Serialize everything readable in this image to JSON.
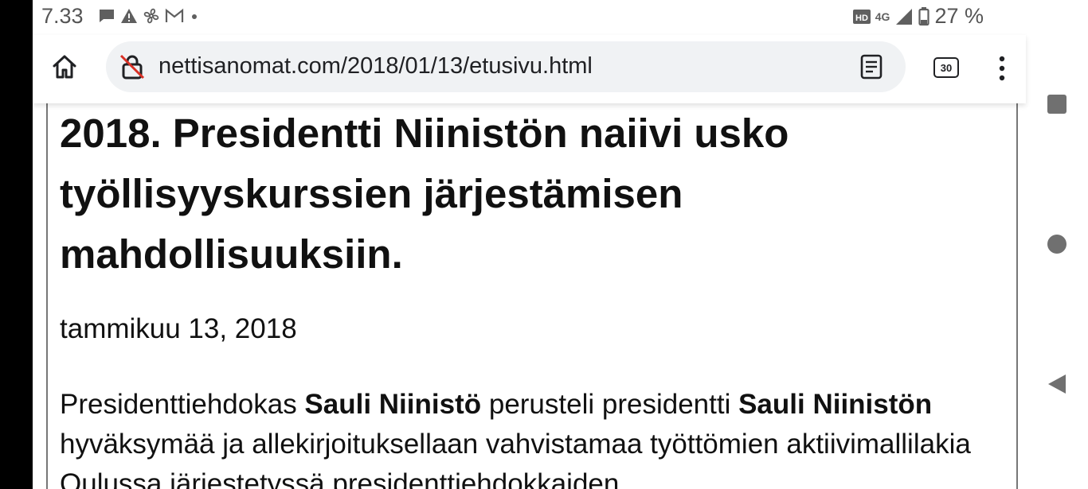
{
  "status_bar": {
    "time": "7.33",
    "network": "4G",
    "hd_badge": "HD",
    "battery": "27 %",
    "icons_left": [
      "chat-bubble-icon",
      "warning-icon",
      "fan-icon",
      "gmail-icon",
      "dot-icon"
    ]
  },
  "browser": {
    "url": "nettisanomat.com/2018/01/13/etusivu.html",
    "tab_count": "30"
  },
  "article": {
    "headline": "2018. Presidentti Niinistön naiivi usko työllisyyskurssien järjestämisen mahdollisuuksiin.",
    "date": "tammikuu 13, 2018",
    "paragraph": {
      "t1": "Presidenttiehdokas ",
      "b1": "Sauli Niinistö",
      "t2": " perusteli presidentti ",
      "b2": "Sauli Niinistön",
      "t3": " hyväksymää ja allekirjoituksellaan vahvistamaa työttömien aktiivimallilakia Oulussa järjestetyssä presidenttiehdokkaiden"
    }
  },
  "colors": {
    "accent_text": "#202124",
    "url_bar_bg": "#f0f2f4",
    "bezel": "#000000"
  }
}
